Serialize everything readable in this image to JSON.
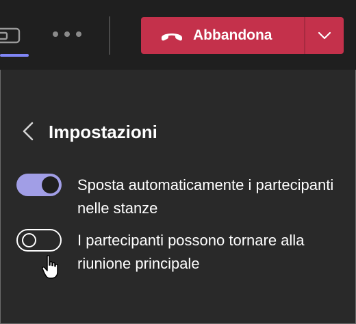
{
  "toolbar": {
    "share_icon": "share-screen-icon",
    "more_icon": "more-options-icon",
    "leave": {
      "label": "Abbandona",
      "icon": "hang-up-icon",
      "dropdown_icon": "chevron-down-icon",
      "color": "#c4314b"
    }
  },
  "panel": {
    "back_icon": "chevron-left-icon",
    "title": "Impostazioni",
    "settings": [
      {
        "label": "Sposta automaticamente i partecipanti nelle stanze",
        "enabled": true
      },
      {
        "label": "I partecipanti possono tornare alla riunione principale",
        "enabled": false
      }
    ]
  },
  "colors": {
    "background": "#292929",
    "toolbar_background": "#1f1f1f",
    "toggle_on": "#a19ee6",
    "accent": "#7f85f5"
  }
}
